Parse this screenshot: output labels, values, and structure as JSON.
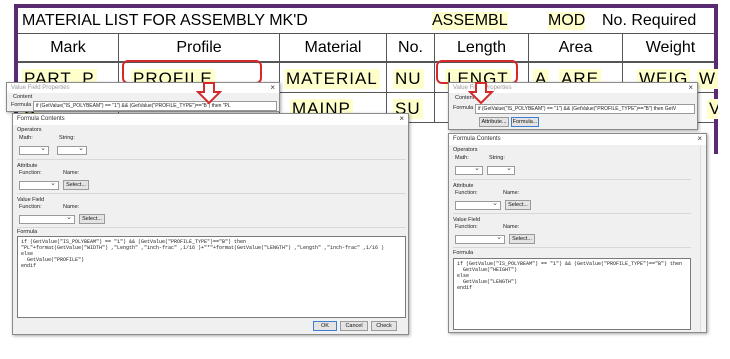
{
  "report": {
    "title": "MATERIAL LIST FOR ASSEMBLY MK'D",
    "title_field1": "ASSEMBL",
    "title_field2": "MOD",
    "title_right": "No. Required",
    "headers": [
      "Mark",
      "Profile",
      "Material",
      "No.",
      "Length",
      "Area",
      "Weight"
    ],
    "row1": [
      "PART_P",
      "PROFILE",
      "MATERIAL",
      "NU",
      "LENGT",
      "A",
      "ARE",
      "WEIG",
      "W"
    ],
    "row2": [
      "S",
      "MAINP",
      "SU",
      "V"
    ]
  },
  "left_vfp": {
    "title": "Value Field Properties",
    "content_label": "Content",
    "formula_label": "Formula",
    "formula_value": "if (GetValue(\"IS_POLYBEAM\") == \"1\") && (GetValue(\"PROFILE_TYPE\")==\"B\") then \"PL"
  },
  "right_vfp": {
    "title": "Value Field Properties",
    "content_label": "Content",
    "formula_label": "Formula",
    "formula_value": "if (GetValue(\"IS_POLYBEAM\") == \"1\") && (GetValue(\"PROFILE_TYPE\")==\"B\") then  GetV",
    "attribute_button": "Attribute...",
    "formula_button": "Formula..."
  },
  "left_fc": {
    "title": "Formula Contents",
    "operators_label": "Operators",
    "math_label": "Math:",
    "string_label": "String:",
    "attribute_label": "Attribute",
    "function_label": "Function:",
    "name_label": "Name:",
    "select_button": "Select...",
    "value_field_label": "Value Field",
    "vf_function_label": "Function:",
    "vf_name_label": "Name:",
    "vf_select_button": "Select...",
    "formula_label": "Formula",
    "formula_text": "if (GetValue(\"IS_POLYBEAM\") == \"1\") && (GetValue(\"PROFILE_TYPE\")==\"B\") then\n\"PL\"+format(GetValue(\"WIDTH\") ,\"Length\" ,\"inch-frac\" ,1/16 )+\"*\"+format(GetValue(\"LENGTH\") ,\"Length\" ,\"inch-frac\" ,1/16 )\nelse\n  GetValue(\"PROFILE\")\nendif",
    "ok_button": "OK",
    "cancel_button": "Cancel",
    "check_button": "Check"
  },
  "right_fc": {
    "title": "Formula Contents",
    "operators_label": "Operators",
    "math_label": "Math:",
    "string_label": "String:",
    "attribute_label": "Attribute",
    "function_label": "Function:",
    "name_label": "Name:",
    "select_button": "Select...",
    "value_field_label": "Value Field",
    "vf_function_label": "Function:",
    "vf_name_label": "Name:",
    "vf_select_button": "Select...",
    "formula_label": "Formula",
    "formula_text": "if (GetValue(\"IS_POLYBEAM\") == \"1\") && (GetValue(\"PROFILE_TYPE\")==\"B\") then\n  GetValue(\"HEIGHT\")\nelse\n  GetValue(\"LENGTH\")\nendif"
  },
  "colors": {
    "frame": "#5a2a72",
    "highlight": "#ffffcc",
    "annotation_red": "#d42a2a",
    "dialog_bg": "#f0f0f0"
  }
}
